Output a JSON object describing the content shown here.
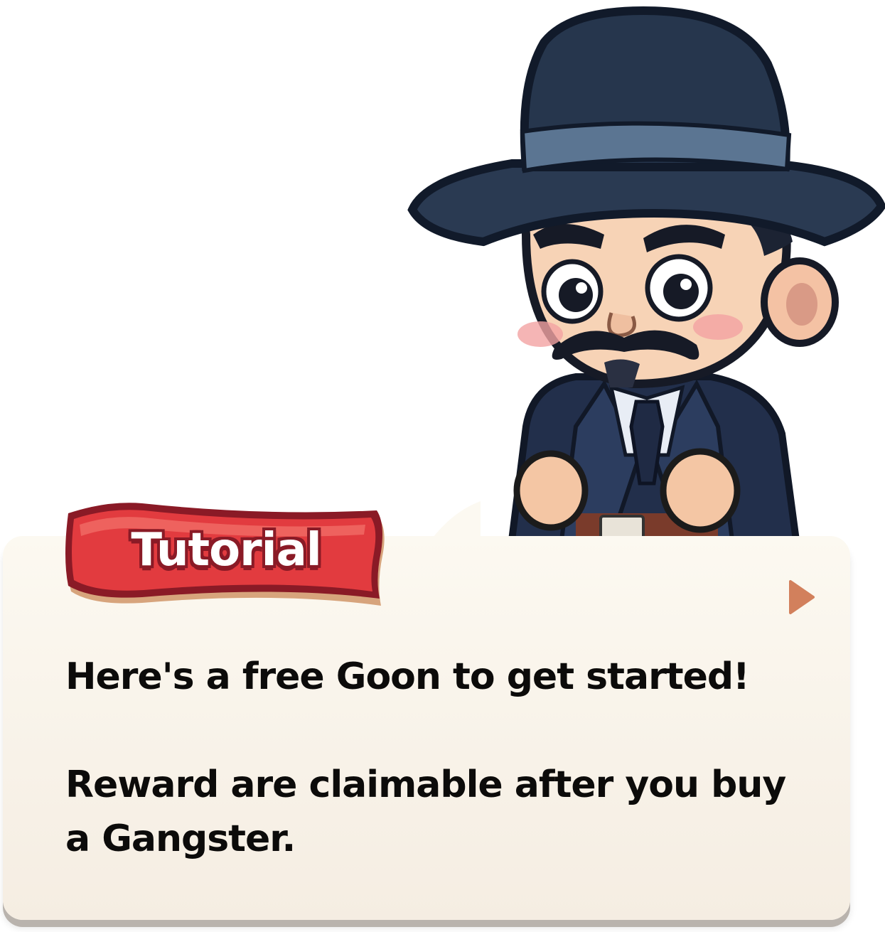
{
  "tutorial": {
    "badge_label": "Tutorial",
    "message_line_1": "Here's a free Goon to get started!",
    "message_line_2": "Reward are claimable after you buy",
    "message_line_3": "a Gangster.",
    "next_icon": "play-arrow-icon",
    "character_icon": "gangster-mascot-icon"
  },
  "colors": {
    "ribbon_red": "#e23b3f",
    "ribbon_outline": "#8a1a26",
    "panel_background": "#f8f2e8",
    "arrow_color": "#d2805c",
    "hat_navy": "#26364d"
  }
}
